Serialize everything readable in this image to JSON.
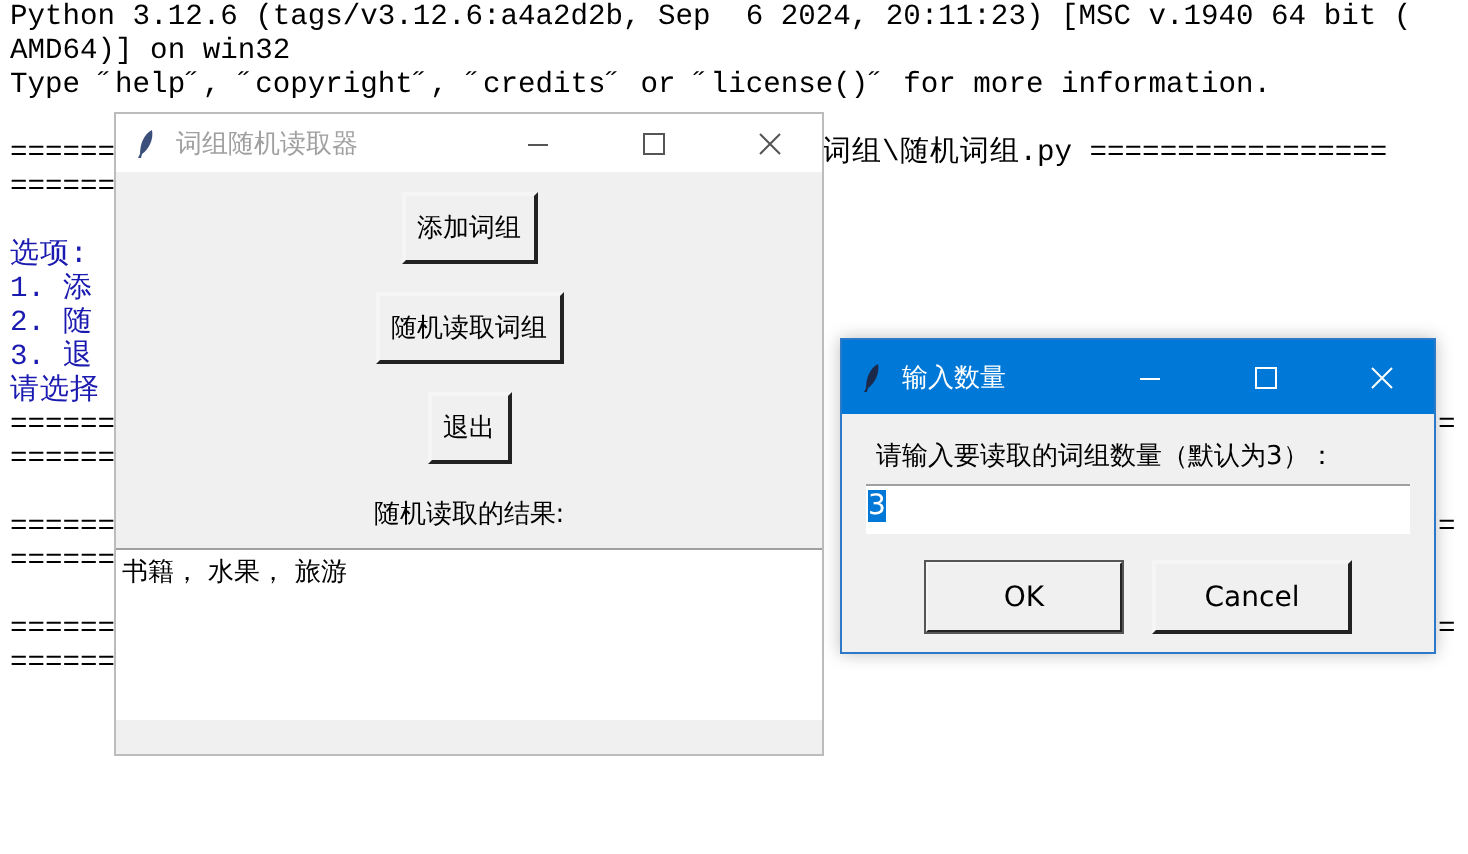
{
  "shell": {
    "lines": [
      {
        "text": "Python 3.12.6 (tags/v3.12.6:a4a2d2b, Sep  6 2024, 20:11:23) [MSC v.1940 64 bit (",
        "kind": "output"
      },
      {
        "text": "AMD64)] on win32",
        "kind": "output"
      },
      {
        "text": "Type ˝help˝, ˝copyright˝, ˝credits˝ or ˝license()˝ for more information.",
        "kind": "output"
      },
      {
        "kind": "blank"
      },
      {
        "text": "======",
        "kind": "output",
        "tail": {
          "text": "词组\\随机词组.py =================",
          "kind": "after_main"
        }
      },
      {
        "text": "======",
        "kind": "output"
      },
      {
        "kind": "blank"
      },
      {
        "text": "选项:",
        "kind": "program"
      },
      {
        "text": "1. 添",
        "kind": "program"
      },
      {
        "text": "2. 随",
        "kind": "program"
      },
      {
        "text": "3. 退",
        "kind": "program"
      },
      {
        "text": "请选择",
        "kind": "program"
      },
      {
        "text": "======",
        "kind": "output",
        "tail": {
          "text": "=",
          "kind": "after_dialog"
        }
      },
      {
        "text": "======",
        "kind": "output"
      },
      {
        "kind": "blank"
      },
      {
        "text": "======",
        "kind": "output",
        "tail": {
          "text": "=",
          "kind": "after_dialog"
        }
      },
      {
        "text": "======",
        "kind": "output"
      },
      {
        "kind": "blank"
      },
      {
        "text": "======",
        "kind": "output",
        "tail": {
          "text": "=",
          "kind": "after_dialog"
        }
      },
      {
        "text": "======",
        "kind": "output"
      }
    ]
  },
  "main_window": {
    "title": "词组随机读取器",
    "active": false,
    "buttons": [
      "添加词组",
      "随机读取词组",
      "退出"
    ],
    "result_label": "随机读取的结果:",
    "result_text": "书籍， 水果， 旅游"
  },
  "dialog": {
    "title": "输入数量",
    "active": true,
    "prompt": "请输入要读取的词组数量（默认为3）：",
    "input": {
      "value": "3",
      "selected": true
    },
    "buttons": [
      {
        "label": "OK",
        "default": true
      },
      {
        "label": "Cancel",
        "default": false
      }
    ]
  }
}
